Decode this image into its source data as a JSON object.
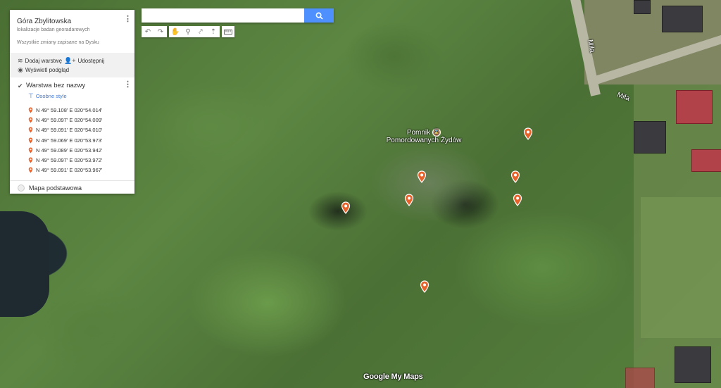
{
  "panel": {
    "title": "Góra Zbylitowska",
    "description": "lokalizacje badan georadarowych",
    "save_status": "Wszystkie zmiany zapisane na Dysku",
    "actions": {
      "add_layer": "Dodaj warstwę",
      "share": "Udostępnij",
      "preview": "Wyświetl podgląd"
    },
    "layer": {
      "name": "Warstwa bez nazwy",
      "style_link": "Osobne style",
      "items": [
        {
          "label": "N 49° 59.108' E 020°54.014'"
        },
        {
          "label": "N 49° 59.097' E 020°54.009'"
        },
        {
          "label": "N 49° 59.091' E 020°54.010'"
        },
        {
          "label": "N 49° 59.069' E 020°53.973'"
        },
        {
          "label": "N 49° 59.089' E 020°53.942'"
        },
        {
          "label": "N 49° 59.097' E 020°53.972'"
        },
        {
          "label": "N 49° 59.091' E 020°53.967'"
        }
      ]
    },
    "basemap_label": "Mapa podstawowa"
  },
  "search": {
    "value": "",
    "placeholder": ""
  },
  "toolbar": {
    "icons": [
      "undo-icon",
      "redo-icon",
      "hand-icon",
      "marker-icon",
      "line-icon",
      "route-icon",
      "ruler-icon"
    ]
  },
  "map": {
    "road_labels": [
      "Miła",
      "Miła"
    ],
    "poi_label_line1": "Pomnik",
    "poi_label_line2": "Pomordowanych Żydów",
    "logo": "Google My Maps"
  },
  "colors": {
    "marker": "#e8632c",
    "search_button": "#4d90fe",
    "link": "#3c78d8"
  }
}
